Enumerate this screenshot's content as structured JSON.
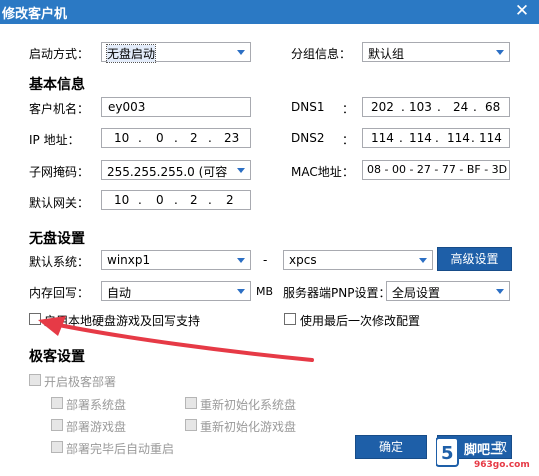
{
  "window": {
    "title": "修改客户机",
    "close_glyph": "✕"
  },
  "boot": {
    "label": "启动方式：",
    "value": "无盘启动",
    "group_label": "分组信息：",
    "group_value": "默认组"
  },
  "basic": {
    "section_title": "基本信息",
    "client_name_label": "客户机名：",
    "client_name": "ey003",
    "dns1_label": "DNS1",
    "dns1_colon": "：",
    "dns1": [
      "202",
      "103",
      "24",
      "68"
    ],
    "ip_label": "IP  地址：",
    "ip": [
      "10",
      "0",
      "2",
      "23"
    ],
    "dns2_label": "DNS2",
    "dns2_colon": "：",
    "dns2": [
      "114",
      "114",
      "114",
      "114"
    ],
    "mask_label": "子网掩码：",
    "mask_value": "255.255.255.0  (可容",
    "mac_label": "MAC地址",
    "mac_colon": "：",
    "mac": "08 - 00 - 27 - 77 - BF - 3D",
    "gateway_label": "默认网关：",
    "gateway": [
      "10",
      "0",
      "2",
      "2"
    ]
  },
  "diskless": {
    "section_title": "无盘设置",
    "system_label": "默认系统：",
    "system_value": "winxp1",
    "dash": "-",
    "system2_value": "xpcs",
    "advanced_button": "高级设置",
    "cache_label": "内存回写：",
    "cache_value": "自动",
    "cache_unit": "MB",
    "pnp_label": "服务器端PNP设置：",
    "pnp_value": "全局设置",
    "local_disk_label": "启用本地硬盘游戏及回写支持",
    "last_config_label": "使用最后一次修改配置"
  },
  "extreme": {
    "section_title": "极客设置",
    "enable_label": "开启极客部署",
    "deploy_system": "部署系统盘",
    "reinit_system": "重新初始化系统盘",
    "deploy_game": "部署游戏盘",
    "reinit_game": "重新初始化游戏盘",
    "reboot_after": "部署完毕后自动重启"
  },
  "footer": {
    "ok_button": "确定",
    "cancel_button_partial": "取"
  },
  "watermark": {
    "text": "脚吧三",
    "domain": "963go.com"
  },
  "colors": {
    "titlebar": "#2b79c4",
    "button": "#1e5fa8",
    "arrow": "#e63a46"
  }
}
